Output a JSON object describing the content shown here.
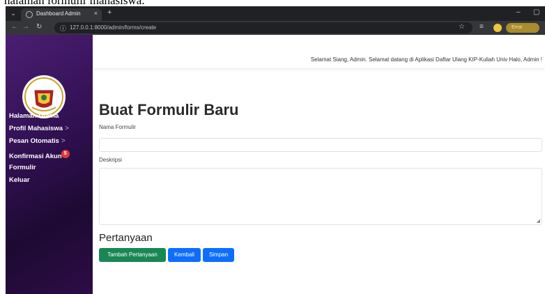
{
  "caption": {
    "text": "halaman formulir mahasiswa."
  },
  "browser": {
    "tab_title": "Dashboard Admin",
    "tab_close": "×",
    "new_tab": "+",
    "url": "127.0.0.1:8000/admin/forms/create",
    "error_label": "Error",
    "icons": [
      "menu-icon",
      "globe-icon",
      "close-icon",
      "back-icon",
      "forward-icon",
      "reload-icon",
      "info-icon",
      "star-icon",
      "extensions-icon",
      "profile-icon",
      "minimize-icon",
      "maximize-icon"
    ]
  },
  "sidebar": {
    "logo_alt": "Universitas Tanjungpura",
    "items": [
      {
        "label": "Halaman Utama",
        "has_chevron": false
      },
      {
        "label": "Profil Mahasiswa",
        "has_chevron": true,
        "chevron": ">"
      },
      {
        "label": "Pesan Otomatis",
        "has_chevron": true,
        "chevron": ">"
      },
      {
        "label": "Konfirmasi Akun",
        "badge": "5"
      },
      {
        "label": "Formulir"
      },
      {
        "label": "Keluar"
      }
    ]
  },
  "header": {
    "greeting": "Selamat Siang, Admin. Selamat datang di Aplikasi Daftar Ulang KIP-Kuliah Univ  Halo, Admin !"
  },
  "form": {
    "title": "Buat Formulir Baru",
    "name_label": "Nama Formulir",
    "name_value": "",
    "description_label": "Deskripsi",
    "description_value": ""
  },
  "questions": {
    "title": "Pertanyaan",
    "add_button": "Tambah Pertanyaan",
    "back_button": "Kembali",
    "save_button": "Simpan"
  },
  "colors": {
    "sidebar_top": "#4a1e72",
    "sidebar_bottom": "#1d0a33",
    "btn_green": "#198754",
    "btn_blue": "#0d6efd",
    "badge": "#e03a3a"
  }
}
